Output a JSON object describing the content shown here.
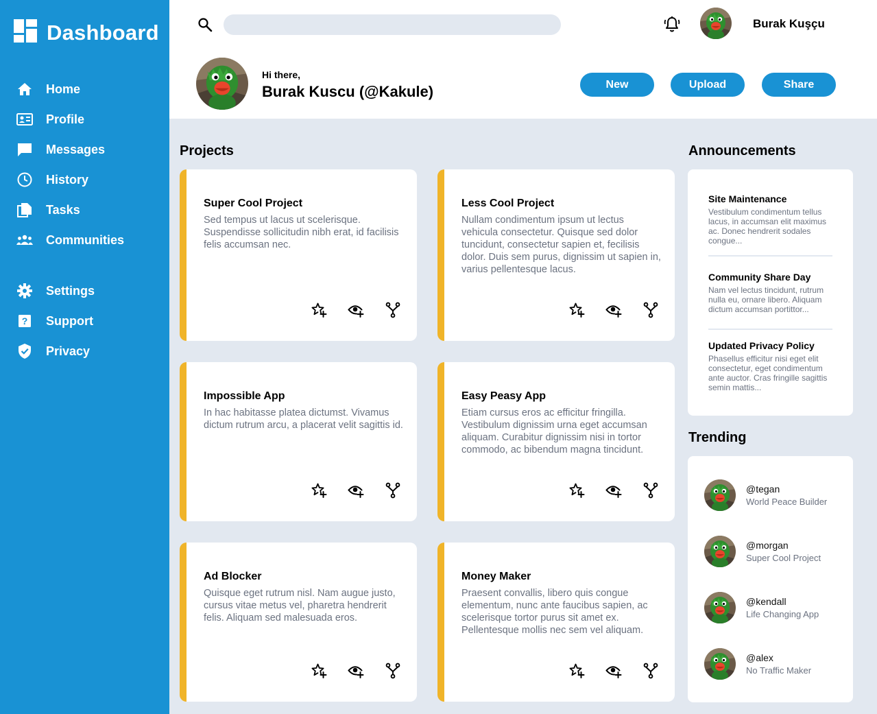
{
  "brand": {
    "title": "Dashboard",
    "icon": "dashboard-icon"
  },
  "sidebar": {
    "items": [
      {
        "label": "Home",
        "icon": "home-icon"
      },
      {
        "label": "Profile",
        "icon": "profile-card-icon"
      },
      {
        "label": "Messages",
        "icon": "message-icon"
      },
      {
        "label": "History",
        "icon": "clock-icon"
      },
      {
        "label": "Tasks",
        "icon": "tasks-icon"
      },
      {
        "label": "Communities",
        "icon": "people-icon"
      },
      {
        "label": "Settings",
        "icon": "gear-icon"
      },
      {
        "label": "Support",
        "icon": "help-icon"
      },
      {
        "label": "Privacy",
        "icon": "shield-icon"
      }
    ]
  },
  "header": {
    "search_placeholder": "",
    "username": "Burak Kuşçu",
    "greeting": "Hi there,",
    "fullname": "Burak Kuscu (@Kakule)",
    "buttons": {
      "new": "New",
      "upload": "Upload",
      "share": "Share"
    }
  },
  "projects": {
    "title": "Projects",
    "cards": [
      {
        "title": "Super Cool Project",
        "desc": "Sed tempus ut lacus ut scelerisque. Suspendisse sollicitudin nibh erat, id facilisis felis accumsan nec."
      },
      {
        "title": "Less Cool Project",
        "desc": "Nullam condimentum ipsum ut lectus vehicula consectetur. Quisque sed dolor tuncidunt, consectetur sapien et, fecilisis dolor. Duis sem purus, dignissim ut sapien in, varius pellentesque lacus."
      },
      {
        "title": "Impossible App",
        "desc": "In hac habitasse platea dictumst. Vivamus dictum rutrum arcu, a placerat velit sagittis id."
      },
      {
        "title": "Easy Peasy App",
        "desc": "Etiam cursus eros ac efficitur fringilla. Vestibulum dignissim urna eget accumsan aliquam. Curabitur dignissim nisi in tortor commodo, ac bibendum magna tincidunt."
      },
      {
        "title": "Ad Blocker",
        "desc": "Quisque eget rutrum nisl. Nam augue justo, cursus vitae metus vel, pharetra hendrerit felis. Aliquam sed malesuada eros."
      },
      {
        "title": "Money Maker",
        "desc": "Praesent convallis, libero quis congue elementum, nunc ante faucibus sapien, ac scelerisque tortor purus sit amet ex. Pellentesque mollis nec sem vel aliquam."
      }
    ]
  },
  "announcements": {
    "title": "Announcements",
    "items": [
      {
        "title": "Site Maintenance",
        "body": "Vestibulum condimentum tellus lacus, in accumsan elit maximus ac. Donec hendrerit sodales congue..."
      },
      {
        "title": "Community Share Day",
        "body": "Nam vel lectus tincidunt, rutrum nulla eu, ornare libero. Aliquam dictum accumsan portittor..."
      },
      {
        "title": "Updated Privacy Policy",
        "body": "Phasellus efficitur nisi eget elit consectetur, eget condimentum ante auctor. Cras fringille sagittis semin mattis..."
      }
    ]
  },
  "trending": {
    "title": "Trending",
    "items": [
      {
        "handle": "@tegan",
        "sub": "World Peace Builder"
      },
      {
        "handle": "@morgan",
        "sub": "Super Cool Project"
      },
      {
        "handle": "@kendall",
        "sub": "Life Changing App"
      },
      {
        "handle": "@alex",
        "sub": "No Traffic Maker"
      }
    ]
  },
  "colors": {
    "primary": "#1992d4",
    "accent": "#f0b429",
    "background": "#e2e8f0",
    "card": "#ffffff",
    "muted_text": "#6b7280"
  }
}
